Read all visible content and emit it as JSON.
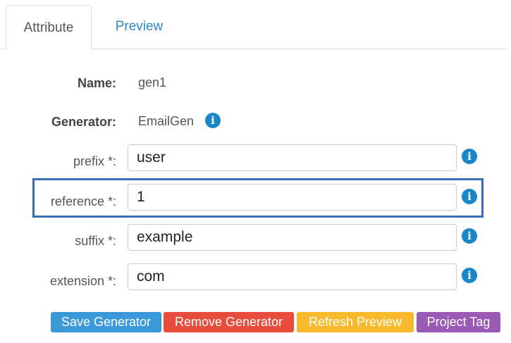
{
  "tabs": [
    {
      "label": "Attribute",
      "active": true
    },
    {
      "label": "Preview",
      "active": false
    }
  ],
  "form": {
    "name_label": "Name:",
    "name_value": "gen1",
    "generator_label": "Generator:",
    "generator_value": "EmailGen",
    "fields": [
      {
        "label": "prefix *:",
        "value": "user"
      },
      {
        "label": "reference *:",
        "value": "1"
      },
      {
        "label": "suffix *:",
        "value": "example"
      },
      {
        "label": "extension *:",
        "value": "com"
      }
    ],
    "info_icon_glyph": "i"
  },
  "buttons": {
    "save": "Save Generator",
    "remove": "Remove Generator",
    "refresh": "Refresh Preview",
    "tag": "Project Tag"
  },
  "colors": {
    "link": "#2f87c8",
    "info_icon": "#1a87c9",
    "highlight": "#3b6db5",
    "save_button": "#3a9ad9",
    "remove_button": "#e74c3c",
    "refresh_button": "#f9b92d",
    "tag_button": "#9b59b6"
  },
  "icons": {
    "info": "info-circle-icon"
  }
}
